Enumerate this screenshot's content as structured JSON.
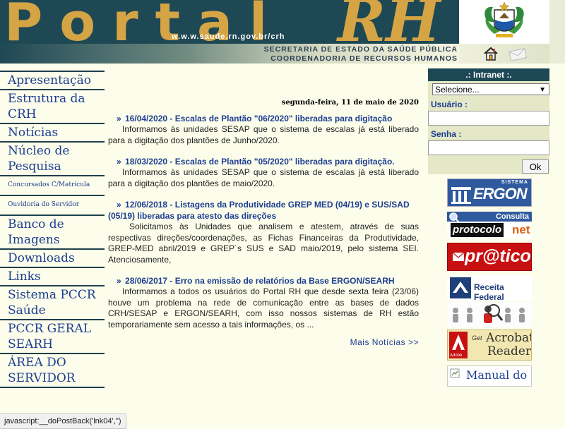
{
  "header": {
    "logo_portal": "Portal",
    "logo_rh": "RH",
    "url": "w.w.w.saude.rn.gov.br/crh",
    "org_line1": "SECRETARIA DE ESTADO DA SAÚDE PÚBLICA",
    "org_line2": "COORDENADORIA DE RECURSOS HUMANOS"
  },
  "nav": {
    "items": [
      {
        "label": "Apresentação"
      },
      {
        "label": "Estrutura da CRH"
      },
      {
        "label": "Notícias"
      },
      {
        "label": "Núcleo de Pesquisa"
      },
      {
        "label": "Concursados C/Matrícula"
      },
      {
        "label": "Ouvidoria do Servidor"
      },
      {
        "label": "Banco de Imagens"
      },
      {
        "label": "Downloads"
      },
      {
        "label": "Links"
      },
      {
        "label": "Sistema PCCR Saúde"
      },
      {
        "label": "PCCR GERAL SEARH"
      },
      {
        "label": "ÁREA DO SERVIDOR"
      }
    ]
  },
  "main": {
    "date": "segunda-feira, 11 de maio de 2020",
    "news": [
      {
        "title": "16/04/2020 - Escalas de Plantão \"06/2020\" liberadas para digitação",
        "body": "Informamos às unidades SESAP que o sistema de escalas já está liberado para a digitação dos plantões de Junho/2020."
      },
      {
        "title": "18/03/2020 - Escalas de Plantão \"05/2020\" liberadas para digitação.",
        "body": "Informamos às unidades SESAP que o sistema de escalas já está liberado para a digitação dos plantões de maio/2020."
      },
      {
        "title": "12/06/2018 - Listagens da Produtividade GREP MED (04/19) e SUS/SAD (05/19) liberadas para atesto das direções",
        "body": "Solicitamos às Unidades que analisem e atestem, através de suas respectivas direções/coordenações, as Fichas Financeiras da Produtividade, GREP-MED abril/2019 e GREP´s SUS e SAD maio/2019, pelo sistema SEI. Atenciosamente,"
      },
      {
        "title": "28/06/2017 - Erro na emissão de relatórios da Base ERGON/SEARH",
        "body": "Informamos a todos os usuários do Portal RH que desde sexta feira (23/06) houve um problema na rede de comunicação entre as bases de dados CRH/SESAP e ERGON/SEARH, com isso nossos sistemas de RH estão temporariamente sem acesso a tais informações, os ..."
      }
    ],
    "more_link": "Mais Notícias >>"
  },
  "intranet": {
    "title": ".: Intranet :.",
    "select_value": "Selecione...",
    "user_label": "Usuário :",
    "password_label": "Senha :",
    "ok_label": "Ok"
  },
  "side_links": {
    "ergon_top": "SISTEMA",
    "ergon": "ERGON",
    "consulta": "Consulta",
    "protocolo": "protocolo",
    "protocolo_net": "net",
    "pratico": "pr@tico",
    "receita": "Receita Federal",
    "acrobat1": "Acrobat",
    "acrobat2": "Reader",
    "acrobat_get": "Get",
    "adobe": "Adobe",
    "manual": "Manual do"
  },
  "status_bar": "javascript:__doPostBack('lnk04','')",
  "colors": {
    "banner": "#1f4855",
    "logo_gold": "#d4a445",
    "link_blue": "#1c3d93",
    "page_bg": "#fcfdea",
    "panel_bg": "#e4e8c7"
  }
}
